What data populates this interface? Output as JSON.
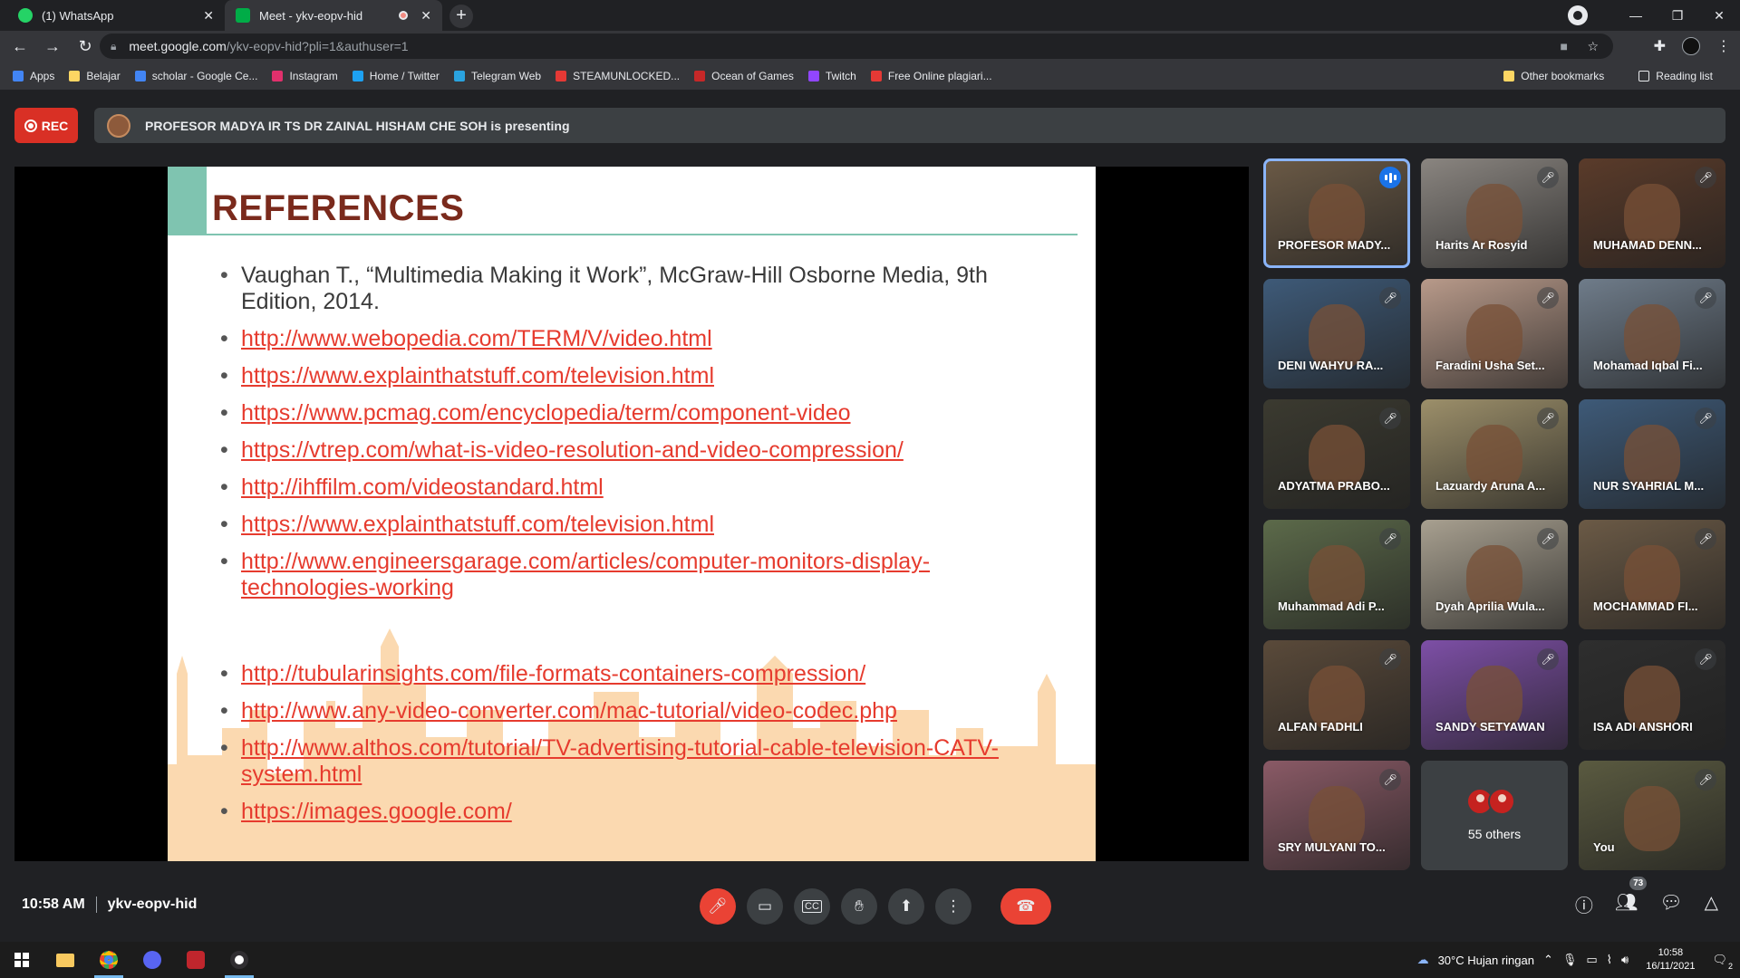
{
  "browser": {
    "tabs": [
      {
        "title": "(1) WhatsApp",
        "favicon_color": "#25d366",
        "active": false
      },
      {
        "title": "Meet - ykv-eopv-hid",
        "favicon_color": "#00ac47",
        "active": true
      }
    ],
    "url_host": "meet.google.com",
    "url_path": "/ykv-eopv-hid?pli=1&authuser=1",
    "bookmarks": [
      {
        "label": "Apps",
        "icon": "apps-grid-icon",
        "color": "#4285f4"
      },
      {
        "label": "Belajar",
        "icon": "folder-icon",
        "color": "#fdd663"
      },
      {
        "label": "scholar - Google Ce...",
        "icon": "scholar-icon",
        "color": "#4285f4"
      },
      {
        "label": "Instagram",
        "icon": "instagram-icon",
        "color": "#e1306c"
      },
      {
        "label": "Home / Twitter",
        "icon": "twitter-icon",
        "color": "#1da1f2"
      },
      {
        "label": "Telegram Web",
        "icon": "telegram-icon",
        "color": "#2aa3df"
      },
      {
        "label": "STEAMUNLOCKED...",
        "icon": "steamunlocked-icon",
        "color": "#e53935"
      },
      {
        "label": "Ocean of Games",
        "icon": "ocean-of-games-icon",
        "color": "#c62828"
      },
      {
        "label": "Twitch",
        "icon": "twitch-icon",
        "color": "#9146ff"
      },
      {
        "label": "Free Online plagiari...",
        "icon": "plagiarism-check-icon",
        "color": "#e53935"
      }
    ],
    "bookmarks_right": [
      {
        "label": "Other bookmarks",
        "icon": "folder-icon"
      },
      {
        "label": "Reading list",
        "icon": "reading-list-icon"
      }
    ]
  },
  "meet": {
    "rec_label": "REC",
    "presenting_text": "PROFESOR MADYA IR TS DR ZAINAL HISHAM CHE SOH is presenting",
    "slide": {
      "title": "REFERENCES",
      "items": [
        {
          "text": "Vaughan T., “Multimedia Making it Work”, McGraw-Hill Osborne Media, 9th Edition, 2014.",
          "link": false
        },
        {
          "text": "http://www.webopedia.com/TERM/V/video.html",
          "link": true
        },
        {
          "text": "https://www.explainthatstuff.com/television.html",
          "link": true
        },
        {
          "text": "https://www.pcmag.com/encyclopedia/term/component-video",
          "link": true
        },
        {
          "text": "https://vtrep.com/what-is-video-resolution-and-video-compression/",
          "link": true
        },
        {
          "text": "http://ihffilm.com/videostandard.html",
          "link": true
        },
        {
          "text": "https://www.explainthatstuff.com/television.html",
          "link": true
        },
        {
          "text": "http://www.engineersgarage.com/articles/computer-monitors-display-technologies-working",
          "link": true
        },
        {
          "text": "http://tubularinsights.com/file-formats-containers-compression/",
          "link": true
        },
        {
          "text": "http://www.any-video-converter.com/mac-tutorial/video-codec.php",
          "link": true
        },
        {
          "text": "http://www.althos.com/tutorial/TV-advertising-tutorial-cable-television-CATV-system.html",
          "link": true
        },
        {
          "text": "https://images.google.com/",
          "link": true
        }
      ]
    },
    "participants": [
      {
        "name": "PROFESOR MADY...",
        "speaking": true,
        "muted": false,
        "bg": "#6b5a46"
      },
      {
        "name": "Harits Ar Rosyid",
        "speaking": false,
        "muted": true,
        "bg": "#8a8580"
      },
      {
        "name": "MUHAMAD DENN...",
        "speaking": false,
        "muted": true,
        "bg": "#5a3b2a"
      },
      {
        "name": "DENI WAHYU RA...",
        "speaking": false,
        "muted": true,
        "bg": "#3e5a78"
      },
      {
        "name": "Faradini Usha Set...",
        "speaking": false,
        "muted": true,
        "bg": "#b89a8a"
      },
      {
        "name": "Mohamad Iqbal Fi...",
        "speaking": false,
        "muted": true,
        "bg": "#6f7c8a"
      },
      {
        "name": "ADYATMA PRABO...",
        "speaking": false,
        "muted": true,
        "bg": "#3b3a30"
      },
      {
        "name": "Lazuardy Aruna A...",
        "speaking": false,
        "muted": true,
        "bg": "#9c8f6a"
      },
      {
        "name": "NUR SYAHRIAL M...",
        "speaking": false,
        "muted": true,
        "bg": "#3e5a78"
      },
      {
        "name": "Muhammad Adi P...",
        "speaking": false,
        "muted": true,
        "bg": "#5c6a4a"
      },
      {
        "name": "Dyah Aprilia Wula...",
        "speaking": false,
        "muted": true,
        "bg": "#a8a090"
      },
      {
        "name": "MOCHAMMAD FI...",
        "speaking": false,
        "muted": true,
        "bg": "#6b5a46"
      },
      {
        "name": "ALFAN FADHLI",
        "speaking": false,
        "muted": true,
        "bg": "#5a4a3a"
      },
      {
        "name": "SANDY SETYAWAN",
        "speaking": false,
        "muted": true,
        "bg": "#7d4fa6"
      },
      {
        "name": "ISA ADI ANSHORI",
        "speaking": false,
        "muted": true,
        "bg": "#2e2e2e"
      },
      {
        "name": "SRY MULYANI TO...",
        "speaking": false,
        "muted": true,
        "bg": "#8a5a66"
      },
      {
        "name": "55 others",
        "others": true
      },
      {
        "name": "You",
        "speaking": false,
        "muted": true,
        "bg": "#5a5a40"
      }
    ],
    "time": "10:58 AM",
    "meeting_code": "ykv-eopv-hid",
    "people_count": "73"
  },
  "taskbar": {
    "weather": "30°C  Hujan ringan",
    "time": "10:58",
    "date": "16/11/2021",
    "notifications": "2"
  }
}
